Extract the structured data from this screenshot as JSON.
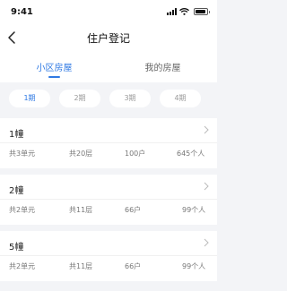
{
  "status_bar": {
    "time": "9:41",
    "icons": [
      "signal-icon",
      "wifi-icon",
      "battery-icon"
    ]
  },
  "nav": {
    "title": "住户登记",
    "back_icon": "chevron-left-icon"
  },
  "tabs": [
    {
      "label": "小区房屋",
      "active": true
    },
    {
      "label": "我的房屋",
      "active": false
    }
  ],
  "phases": [
    {
      "label": "1期",
      "active": true
    },
    {
      "label": "2期",
      "active": false
    },
    {
      "label": "3期",
      "active": false
    },
    {
      "label": "4期",
      "active": false
    }
  ],
  "buildings": [
    {
      "name": "1幢",
      "units": "共3单元",
      "floors": "共20层",
      "households": "100户",
      "people": "645个人"
    },
    {
      "name": "2幢",
      "units": "共2单元",
      "floors": "共11层",
      "households": "66户",
      "people": "99个人"
    },
    {
      "name": "5幢",
      "units": "共2单元",
      "floors": "共11层",
      "households": "66户",
      "people": "99个人"
    }
  ],
  "colors": {
    "accent": "#2f79e3",
    "background": "#f3f4f7"
  }
}
